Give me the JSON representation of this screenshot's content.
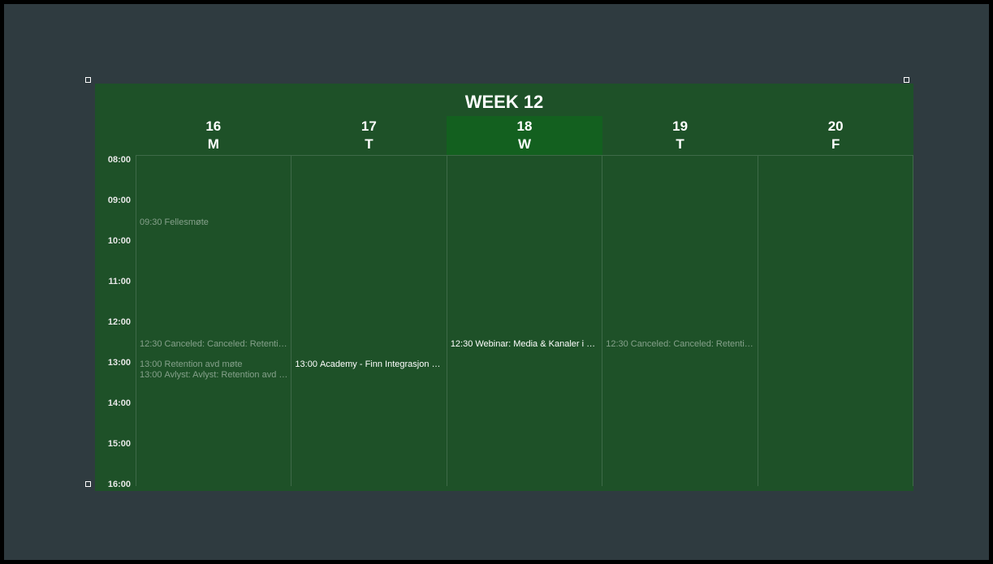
{
  "title": "WEEK 12",
  "hours": [
    "08:00",
    "09:00",
    "10:00",
    "11:00",
    "12:00",
    "13:00",
    "14:00",
    "15:00",
    "16:00"
  ],
  "hourHeight": 50,
  "days": [
    {
      "date": "16",
      "dow": "M",
      "today": false
    },
    {
      "date": "17",
      "dow": "T",
      "today": false
    },
    {
      "date": "18",
      "dow": "W",
      "today": true
    },
    {
      "date": "19",
      "dow": "T",
      "today": false
    },
    {
      "date": "20",
      "dow": "F",
      "today": false
    }
  ],
  "events": [
    {
      "day": 0,
      "time": "09:30",
      "title": "Fellesmøte",
      "canceled": true,
      "slot": 0
    },
    {
      "day": 0,
      "time": "12:30",
      "title": "Canceled: Canceled: Retention avdelingsmøte",
      "canceled": true,
      "slot": 0
    },
    {
      "day": 0,
      "time": "13:00",
      "title": "Retention avd møte",
      "canceled": true,
      "slot": 0
    },
    {
      "day": 0,
      "time": "13:00",
      "title": "Avlyst: Avlyst: Retention avd møte",
      "canceled": true,
      "slot": 1
    },
    {
      "day": 1,
      "time": "13:00",
      "title": "Academy - Finn Integrasjon video",
      "canceled": false,
      "slot": 0
    },
    {
      "day": 2,
      "time": "12:30",
      "title": "Webinar: Media & Kanaler i Databerry",
      "canceled": false,
      "slot": 0
    },
    {
      "day": 3,
      "time": "12:30",
      "title": "Canceled: Canceled: Retention avdelingsmøte",
      "canceled": true,
      "slot": 0
    }
  ]
}
